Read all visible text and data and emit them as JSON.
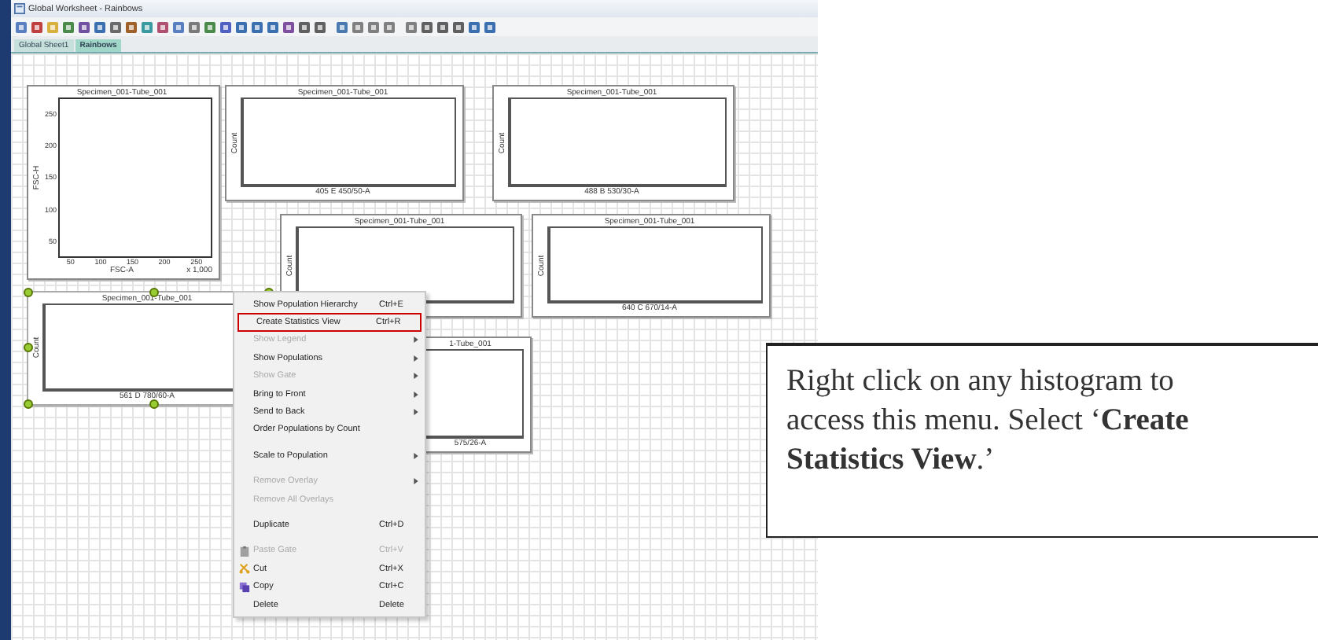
{
  "window": {
    "title": "Global Worksheet - Rainbows"
  },
  "tabs": [
    {
      "label": "Global Sheet1",
      "selected": false
    },
    {
      "label": "Rainbows",
      "selected": true
    }
  ],
  "plots": [
    {
      "kind": "dot",
      "title": "Specimen_001-Tube_001",
      "x_label": "FSC-A",
      "y_label": "FSC-H",
      "x_ticks": [
        "50",
        "100",
        "150",
        "200",
        "250"
      ],
      "y_ticks": [
        "250",
        "200",
        "150",
        "100",
        "50"
      ],
      "scale_note": "x 1,000",
      "selected": false
    },
    {
      "kind": "histogram",
      "title": "Specimen_001-Tube_001",
      "x_label": "405 E 450/50-A",
      "y_label": "Count",
      "selected": false
    },
    {
      "kind": "histogram",
      "title": "Specimen_001-Tube_001",
      "x_label": "488 B 530/30-A",
      "y_label": "Count",
      "selected": false
    },
    {
      "kind": "histogram",
      "title": "Specimen_001-Tube_001",
      "y_label": "Count",
      "selected": false
    },
    {
      "kind": "histogram",
      "title": "Specimen_001-Tube_001",
      "x_label": "640 C 670/14-A",
      "y_label": "Count",
      "selected": false
    },
    {
      "kind": "histogram",
      "title": "Specimen_001-Tube_001",
      "x_label": "561 D 780/60-A",
      "y_label": "Count",
      "selected": true
    },
    {
      "kind": "histogram",
      "title": "1-Tube_001",
      "x_label": "575/26-A",
      "selected": false
    }
  ],
  "context_menu": [
    {
      "kind": "item",
      "label": "Show Population Hierarchy",
      "shortcut": "Ctrl+E",
      "disabled": false,
      "submenu": false,
      "highlighted": false
    },
    {
      "kind": "item",
      "label": "Create Statistics View",
      "shortcut": "Ctrl+R",
      "disabled": false,
      "submenu": false,
      "highlighted": true
    },
    {
      "kind": "item",
      "label": "Show Legend",
      "disabled": true,
      "submenu": true,
      "highlighted": false
    },
    {
      "kind": "item",
      "label": "Show Populations",
      "disabled": false,
      "submenu": true,
      "highlighted": false
    },
    {
      "kind": "item",
      "label": "Show Gate",
      "disabled": true,
      "submenu": true,
      "highlighted": false
    },
    {
      "kind": "item",
      "label": "Bring to Front",
      "disabled": false,
      "submenu": true,
      "highlighted": false
    },
    {
      "kind": "item",
      "label": "Send to Back",
      "disabled": false,
      "submenu": true,
      "highlighted": false
    },
    {
      "kind": "item",
      "label": "Order Populations by Count",
      "disabled": false,
      "submenu": false,
      "highlighted": false
    },
    {
      "kind": "separator"
    },
    {
      "kind": "item",
      "label": "Scale to Population",
      "disabled": false,
      "submenu": true,
      "highlighted": false
    },
    {
      "kind": "separator"
    },
    {
      "kind": "item",
      "label": "Remove Overlay",
      "disabled": true,
      "submenu": true,
      "highlighted": false
    },
    {
      "kind": "item",
      "label": "Remove All Overlays",
      "disabled": true,
      "submenu": false,
      "highlighted": false
    },
    {
      "kind": "separator"
    },
    {
      "kind": "item",
      "label": "Duplicate",
      "shortcut": "Ctrl+D",
      "disabled": false,
      "submenu": false,
      "highlighted": false
    },
    {
      "kind": "separator"
    },
    {
      "kind": "iconitem",
      "label": "Paste Gate",
      "shortcut": "Ctrl+V",
      "disabled": true,
      "submenu": false,
      "highlighted": false
    },
    {
      "kind": "iconitem",
      "label": "Cut",
      "shortcut": "Ctrl+X",
      "disabled": false,
      "submenu": false,
      "highlighted": false
    },
    {
      "kind": "iconitem",
      "label": "Copy",
      "shortcut": "Ctrl+C",
      "disabled": false,
      "submenu": false,
      "highlighted": false
    },
    {
      "kind": "item",
      "label": "Delete",
      "shortcut": "Delete",
      "disabled": false,
      "submenu": false,
      "highlighted": false
    }
  ],
  "callout": {
    "text": "Right click on any histogram to access this menu. Select ‘**Create Statistics View**.’"
  }
}
